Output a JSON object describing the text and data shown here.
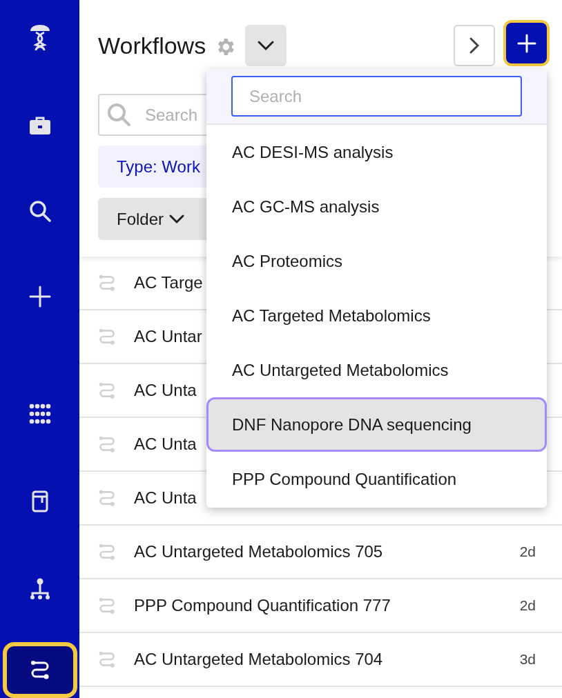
{
  "sidebar": {
    "items": [
      {
        "kind": "logo",
        "selected": false
      },
      {
        "kind": "briefcase",
        "selected": false
      },
      {
        "kind": "search",
        "selected": false
      },
      {
        "kind": "plus",
        "selected": false
      },
      {
        "kind": "apps",
        "selected": false
      },
      {
        "kind": "notebook",
        "selected": false
      },
      {
        "kind": "hierarchy",
        "selected": false
      },
      {
        "kind": "workflow",
        "selected": true
      }
    ]
  },
  "header": {
    "title": "Workflows"
  },
  "filters": {
    "search_placeholder": "Search",
    "chips": [
      {
        "kind": "type",
        "label": "Type: Work"
      },
      {
        "kind": "folder",
        "label": "Folder"
      }
    ]
  },
  "rows": [
    {
      "name": "AC Targe"
    },
    {
      "name": "AC Untar"
    },
    {
      "name": "AC Unta"
    },
    {
      "name": "AC Unta"
    },
    {
      "name": "AC Unta"
    },
    {
      "name": "AC Untargeted Metabolomics 705",
      "age": "2d"
    },
    {
      "name": "PPP Compound Quantification 777",
      "age": "2d"
    },
    {
      "name": "AC Untargeted Metabolomics 704",
      "age": "3d"
    }
  ],
  "dropdown": {
    "search_placeholder": "Search",
    "items": [
      {
        "label": "AC DESI-MS analysis",
        "selected": false
      },
      {
        "label": "AC GC-MS analysis",
        "selected": false
      },
      {
        "label": "AC Proteomics",
        "selected": false
      },
      {
        "label": "AC Targeted Metabolomics",
        "selected": false
      },
      {
        "label": "AC Untargeted Metabolomics",
        "selected": false
      },
      {
        "label": "DNF Nanopore DNA sequencing",
        "selected": true
      },
      {
        "label": "PPP Compound Quantification",
        "selected": false
      }
    ]
  }
}
